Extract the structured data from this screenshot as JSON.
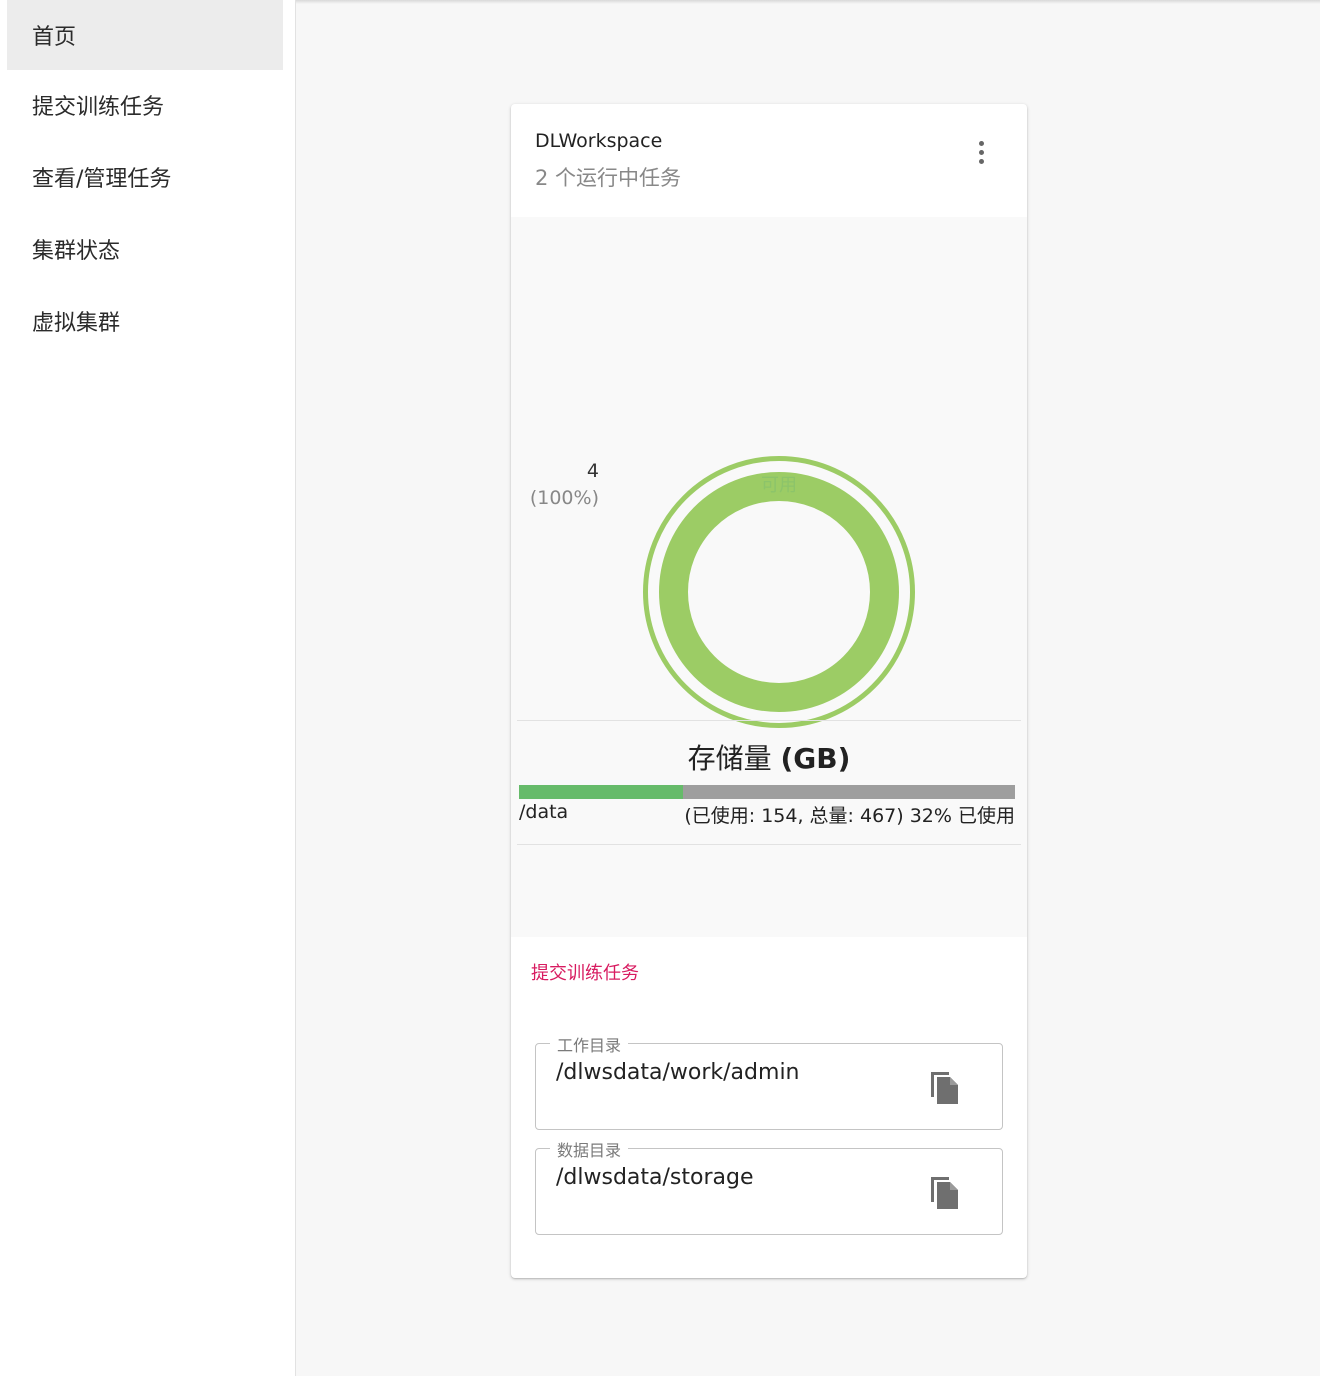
{
  "nav": {
    "items": [
      {
        "label": "首页",
        "active": true
      },
      {
        "label": "提交训练任务"
      },
      {
        "label": "查看/管理任务"
      },
      {
        "label": "集群状态"
      },
      {
        "label": "虚拟集群"
      }
    ]
  },
  "card": {
    "title": "DLWorkspace",
    "subtitle": "2 个运行中任务",
    "more_icon": "more-vert-icon",
    "gpu_chart": {
      "type": "pie",
      "segments": [
        {
          "label": "可用",
          "value": 4,
          "percent": "(100%)",
          "color": "#9ccc65"
        }
      ],
      "legend_count": "4",
      "legend_percent": "(100%)",
      "center_label": "可用"
    },
    "storage": {
      "title_prefix": "存储量 ",
      "title_unit": "(GB)",
      "path": "/data",
      "used": 154,
      "total": 467,
      "usage_text": "(已使用: 154, 总量: 467) 32% 已使用",
      "used_fraction": 0.33,
      "used_color": "#66bb6a",
      "free_color": "#9e9e9e"
    },
    "submit_link": "提交训练任务",
    "work_dir": {
      "label": "工作目录",
      "value": "/dlwsdata/work/admin",
      "icon": "copy-icon"
    },
    "data_dir": {
      "label": "数据目录",
      "value": "/dlwsdata/storage",
      "icon": "copy-icon"
    }
  }
}
